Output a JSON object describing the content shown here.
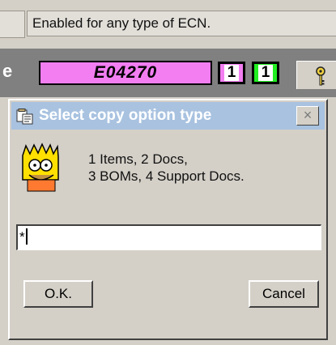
{
  "status": {
    "message": "Enabled for any type of ECN."
  },
  "ecn": {
    "partial_label": "e",
    "number": "E04270",
    "badge_pink": "1",
    "badge_green": "1"
  },
  "dialog": {
    "title": "Select copy option type",
    "close_symbol": "×",
    "message_lines": [
      "1 Items, 2 Docs,",
      "3 BOMs, 4 Support Docs."
    ],
    "input_value": "*",
    "ok_label": "O.K.",
    "cancel_label": "Cancel"
  },
  "colors": {
    "ecn_pink": "#f27ef2",
    "ecn_green": "#22ee22",
    "titlebar": "#a8c2e0",
    "window_bg": "#d4d0c8"
  },
  "icons": {
    "key": "key-icon",
    "title": "copy-window-icon",
    "avatar": "bart-avatar-icon"
  }
}
